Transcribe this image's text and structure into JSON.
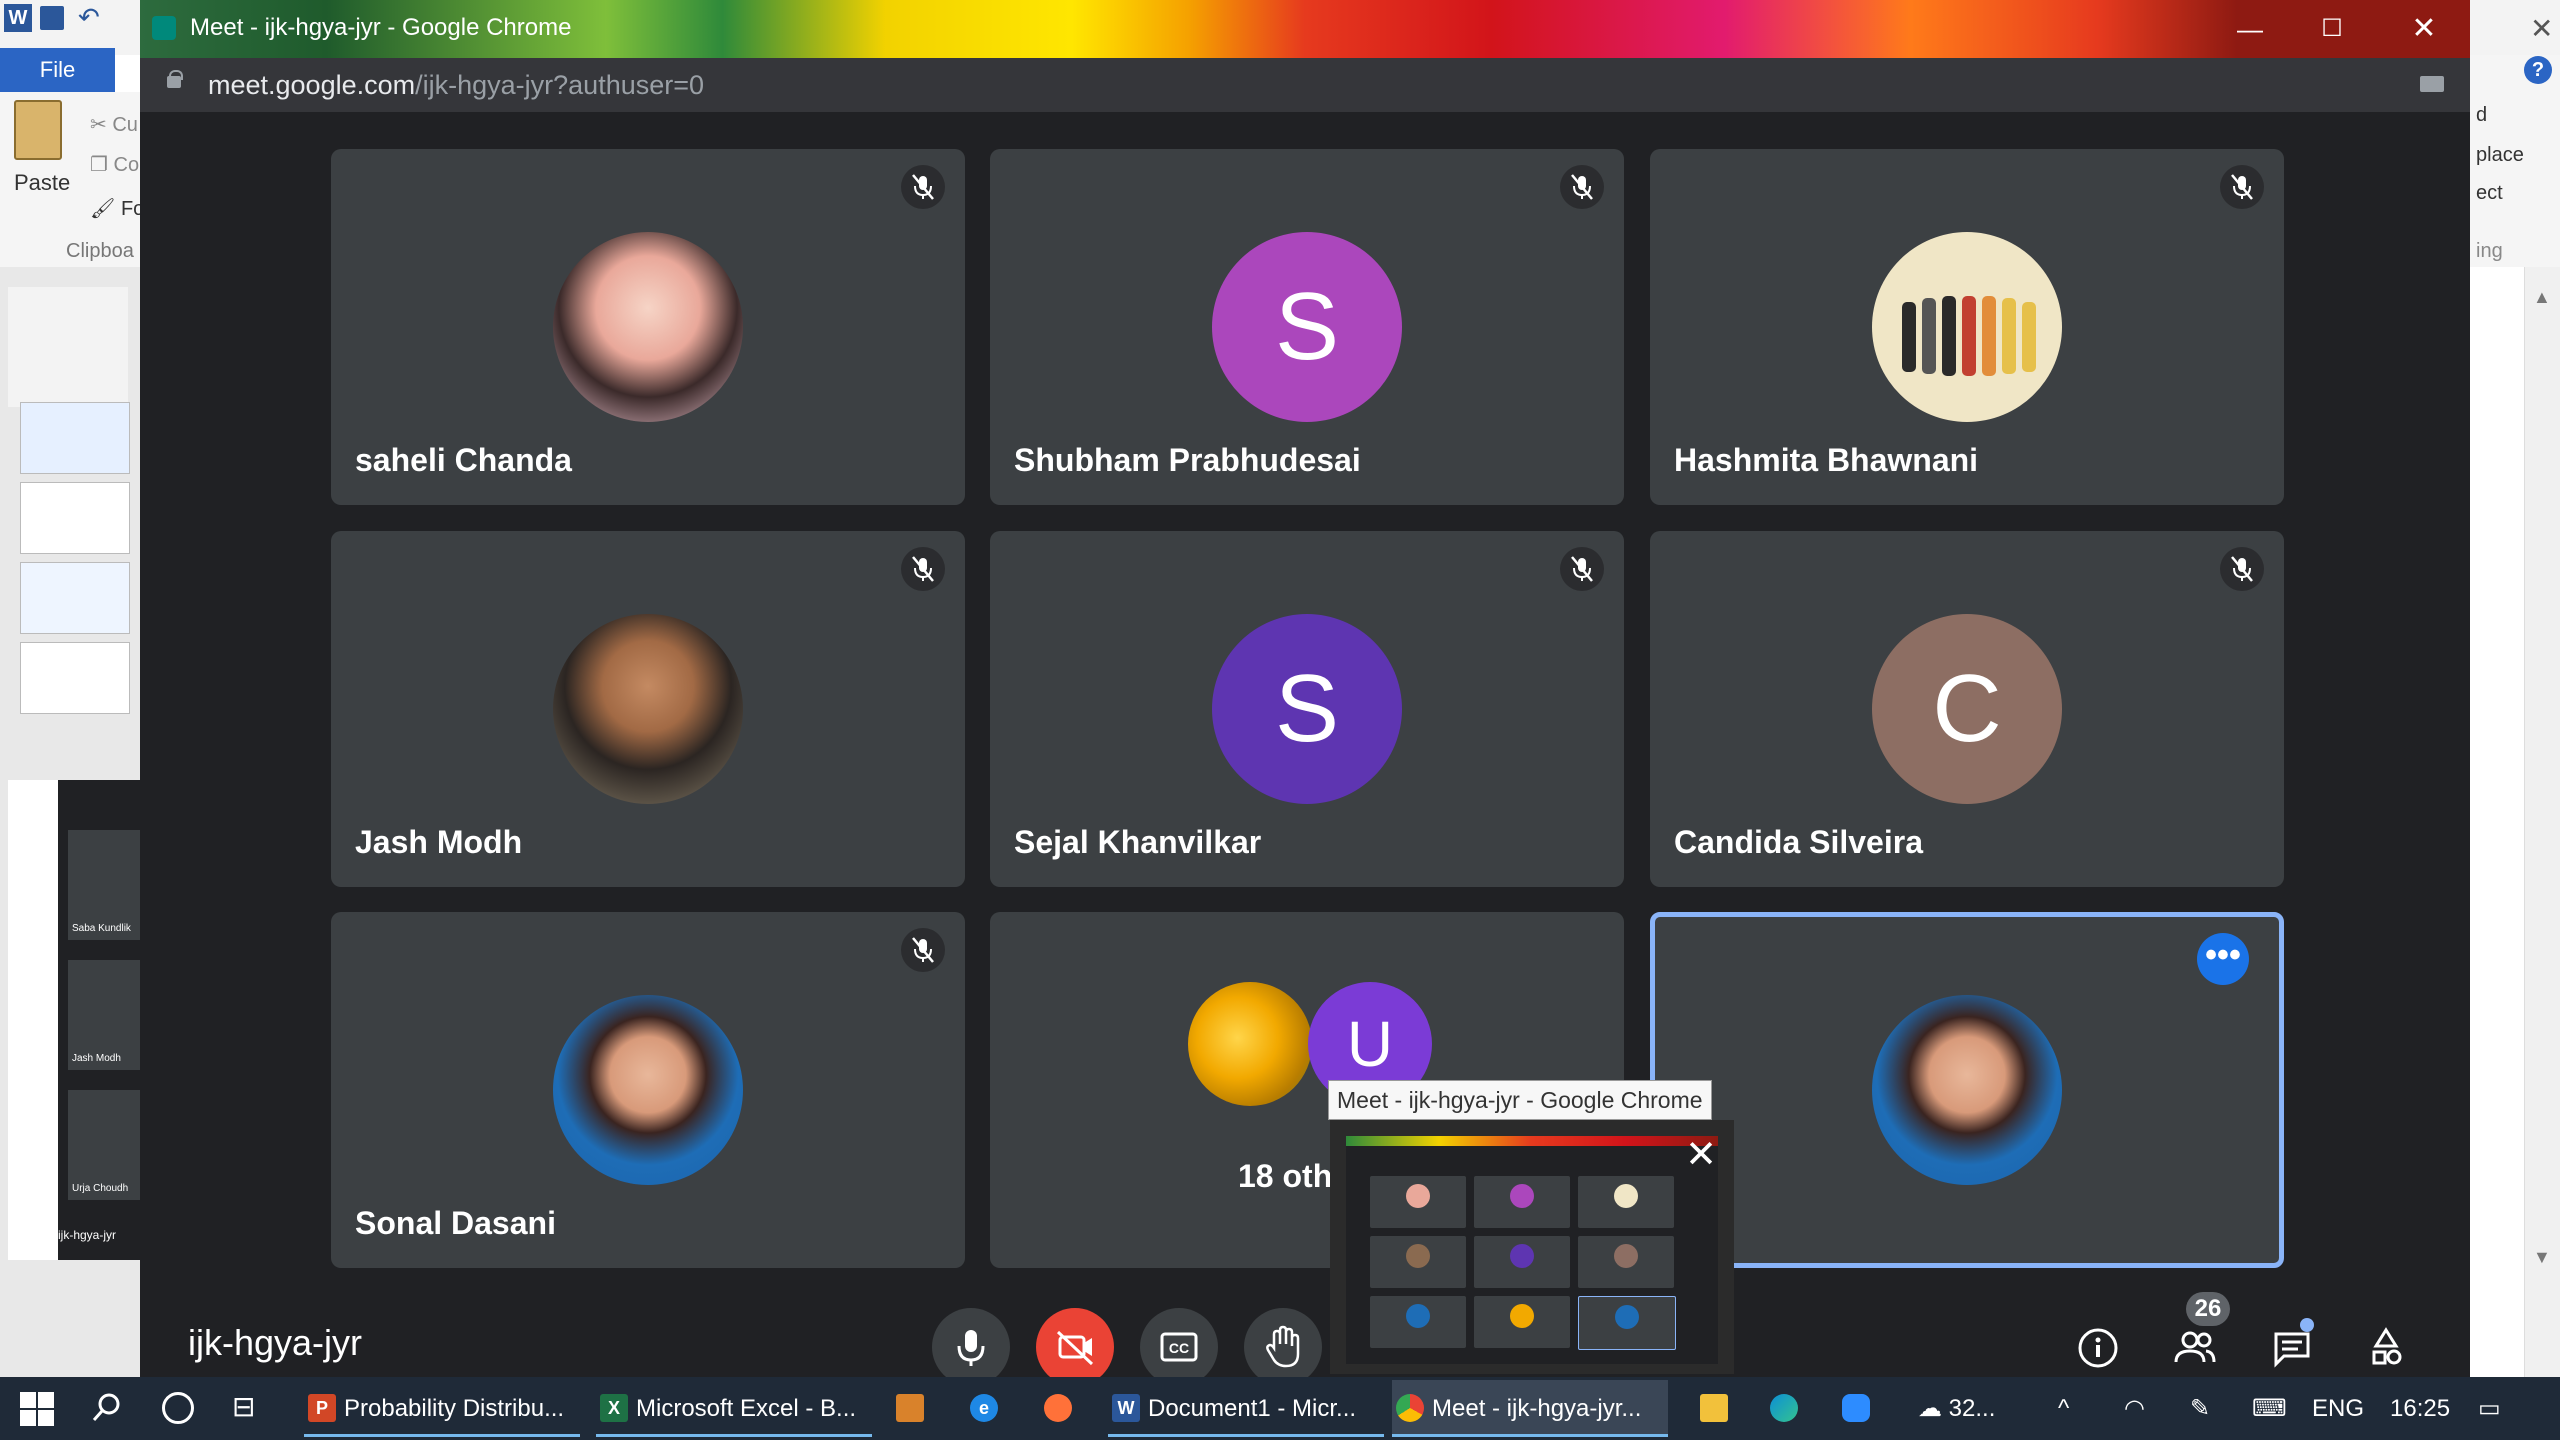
{
  "background": {
    "word_qat_icon": "W",
    "word_file_tab": "File",
    "ribbon": {
      "paste": "Paste",
      "cut": "Cu",
      "copy": "Co",
      "format_painter": "Fo",
      "clipboard": "Clipboa"
    },
    "right_ribbon": {
      "r1": "d",
      "r2": "place",
      "r3": "ect",
      "r4": "ing"
    },
    "help": "?",
    "mini_meet_names": [
      "Saba Kundlik",
      "Jash Modh",
      "Urja Choudh"
    ],
    "mini_meet_title": "ijk-hgya-jyr"
  },
  "chrome": {
    "window_title": "Meet - ijk-hgya-jyr - Google Chrome",
    "url_host": "meet.google.com",
    "url_path": "/ijk-hgya-jyr?authuser=0",
    "min_glyph": "—",
    "max_glyph": "☐",
    "close_glyph": "✕"
  },
  "meet": {
    "participants": [
      {
        "name": "saheli Chanda",
        "avatar": "photo",
        "muted": true
      },
      {
        "name": "Shubham Prabhudesai",
        "avatar": "letter",
        "letter": "S",
        "color": "#ab47bc",
        "muted": true
      },
      {
        "name": "Hashmita Bhawnani",
        "avatar": "photo",
        "muted": true
      },
      {
        "name": "Jash Modh",
        "avatar": "photo",
        "muted": true
      },
      {
        "name": "Sejal Khanvilkar",
        "avatar": "letter",
        "letter": "S",
        "color": "#5e35b1",
        "muted": true
      },
      {
        "name": "Candida Silveira",
        "avatar": "letter",
        "letter": "C",
        "color": "#8d6e63",
        "muted": true
      },
      {
        "name": "Sonal Dasani",
        "avatar": "photo",
        "muted": true
      }
    ],
    "others": {
      "label": "18 othe",
      "letter": "U",
      "color": "#7b3bd6"
    },
    "self_more": "•••",
    "meeting_code": "ijk-hgya-jyr",
    "people_count": "26",
    "controls": {
      "mic": "mic-icon",
      "camera": "camera-off-icon",
      "captions": "captions-icon",
      "raise_hand": "raise-hand-icon",
      "info": "info-icon",
      "people": "people-icon",
      "chat": "chat-icon",
      "activities": "activities-icon"
    }
  },
  "preview": {
    "tooltip": "Meet - ijk-hgya-jyr - Google Chrome",
    "close": "✕"
  },
  "taskbar": {
    "apps": [
      {
        "label": "Probability Distribu...",
        "icon_color": "#d24726",
        "letter": "P"
      },
      {
        "label": "Microsoft Excel - B...",
        "icon_color": "#1e7145",
        "letter": "X"
      },
      {
        "label": "",
        "icon_color": "#d9822b",
        "letter": ""
      },
      {
        "label": "",
        "icon_color": "#1e88e5",
        "letter": "e"
      },
      {
        "label": "",
        "icon_color": "#ff7139",
        "letter": ""
      },
      {
        "label": "Document1 - Micr...",
        "icon_color": "#2b579a",
        "letter": "W"
      },
      {
        "label": "Meet - ijk-hgya-jyr...",
        "icon_color": "#34a853",
        "letter": ""
      }
    ],
    "tray": {
      "weather": "32...",
      "lang": "ENG",
      "time": "16:25"
    }
  }
}
